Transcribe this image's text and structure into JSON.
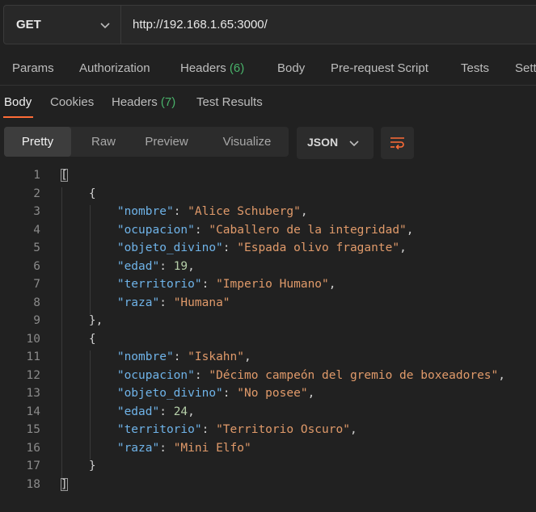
{
  "request": {
    "method": "GET",
    "url": "http://192.168.1.65:3000/"
  },
  "request_tabs": [
    {
      "label": "Params",
      "count": ""
    },
    {
      "label": "Authorization",
      "count": ""
    },
    {
      "label": "Headers",
      "count": "(6)"
    },
    {
      "label": "Body",
      "count": ""
    },
    {
      "label": "Pre-request Script",
      "count": ""
    },
    {
      "label": "Tests",
      "count": ""
    },
    {
      "label": "Sett",
      "count": ""
    }
  ],
  "response_tabs": [
    {
      "label": "Body",
      "count": ""
    },
    {
      "label": "Cookies",
      "count": ""
    },
    {
      "label": "Headers",
      "count": "(7)"
    },
    {
      "label": "Test Results",
      "count": ""
    }
  ],
  "view_modes": [
    "Pretty",
    "Raw",
    "Preview",
    "Visualize"
  ],
  "active_view_mode": "Pretty",
  "format": "JSON",
  "colors": {
    "accent": "#ff6c37",
    "count": "#49b26a",
    "key": "#6fb3e8",
    "string": "#e09a6a",
    "number": "#b5cea8"
  },
  "response_body": [
    {
      "nombre": "Alice Schuberg",
      "ocupacion": "Caballero de la integridad",
      "objeto_divino": "Espada olivo fragante",
      "edad": 19,
      "territorio": "Imperio Humano",
      "raza": "Humana"
    },
    {
      "nombre": "Iskahn",
      "ocupacion": "Décimo campeón del gremio de boxeadores",
      "objeto_divino": "No posee",
      "edad": 24,
      "territorio": "Territorio Oscuro",
      "raza": "Mini Elfo"
    }
  ],
  "code_lines": [
    {
      "n": "1",
      "tokens": [
        {
          "t": "p",
          "v": "["
        }
      ]
    },
    {
      "n": "2",
      "tokens": [
        {
          "t": "p",
          "v": "    {"
        }
      ]
    },
    {
      "n": "3",
      "tokens": [
        {
          "t": "p",
          "v": "        "
        },
        {
          "t": "k",
          "v": "\"nombre\""
        },
        {
          "t": "p",
          "v": ": "
        },
        {
          "t": "s",
          "v": "\"Alice Schuberg\""
        },
        {
          "t": "p",
          "v": ","
        }
      ]
    },
    {
      "n": "4",
      "tokens": [
        {
          "t": "p",
          "v": "        "
        },
        {
          "t": "k",
          "v": "\"ocupacion\""
        },
        {
          "t": "p",
          "v": ": "
        },
        {
          "t": "s",
          "v": "\"Caballero de la integridad\""
        },
        {
          "t": "p",
          "v": ","
        }
      ]
    },
    {
      "n": "5",
      "tokens": [
        {
          "t": "p",
          "v": "        "
        },
        {
          "t": "k",
          "v": "\"objeto_divino\""
        },
        {
          "t": "p",
          "v": ": "
        },
        {
          "t": "s",
          "v": "\"Espada olivo fragante\""
        },
        {
          "t": "p",
          "v": ","
        }
      ]
    },
    {
      "n": "6",
      "tokens": [
        {
          "t": "p",
          "v": "        "
        },
        {
          "t": "k",
          "v": "\"edad\""
        },
        {
          "t": "p",
          "v": ": "
        },
        {
          "t": "n",
          "v": "19"
        },
        {
          "t": "p",
          "v": ","
        }
      ]
    },
    {
      "n": "7",
      "tokens": [
        {
          "t": "p",
          "v": "        "
        },
        {
          "t": "k",
          "v": "\"territorio\""
        },
        {
          "t": "p",
          "v": ": "
        },
        {
          "t": "s",
          "v": "\"Imperio Humano\""
        },
        {
          "t": "p",
          "v": ","
        }
      ]
    },
    {
      "n": "8",
      "tokens": [
        {
          "t": "p",
          "v": "        "
        },
        {
          "t": "k",
          "v": "\"raza\""
        },
        {
          "t": "p",
          "v": ": "
        },
        {
          "t": "s",
          "v": "\"Humana\""
        }
      ]
    },
    {
      "n": "9",
      "tokens": [
        {
          "t": "p",
          "v": "    },"
        }
      ]
    },
    {
      "n": "10",
      "tokens": [
        {
          "t": "p",
          "v": "    {"
        }
      ]
    },
    {
      "n": "11",
      "tokens": [
        {
          "t": "p",
          "v": "        "
        },
        {
          "t": "k",
          "v": "\"nombre\""
        },
        {
          "t": "p",
          "v": ": "
        },
        {
          "t": "s",
          "v": "\"Iskahn\""
        },
        {
          "t": "p",
          "v": ","
        }
      ]
    },
    {
      "n": "12",
      "tokens": [
        {
          "t": "p",
          "v": "        "
        },
        {
          "t": "k",
          "v": "\"ocupacion\""
        },
        {
          "t": "p",
          "v": ": "
        },
        {
          "t": "s",
          "v": "\"Décimo campeón del gremio de boxeadores\""
        },
        {
          "t": "p",
          "v": ","
        }
      ]
    },
    {
      "n": "13",
      "tokens": [
        {
          "t": "p",
          "v": "        "
        },
        {
          "t": "k",
          "v": "\"objeto_divino\""
        },
        {
          "t": "p",
          "v": ": "
        },
        {
          "t": "s",
          "v": "\"No posee\""
        },
        {
          "t": "p",
          "v": ","
        }
      ]
    },
    {
      "n": "14",
      "tokens": [
        {
          "t": "p",
          "v": "        "
        },
        {
          "t": "k",
          "v": "\"edad\""
        },
        {
          "t": "p",
          "v": ": "
        },
        {
          "t": "n",
          "v": "24"
        },
        {
          "t": "p",
          "v": ","
        }
      ]
    },
    {
      "n": "15",
      "tokens": [
        {
          "t": "p",
          "v": "        "
        },
        {
          "t": "k",
          "v": "\"territorio\""
        },
        {
          "t": "p",
          "v": ": "
        },
        {
          "t": "s",
          "v": "\"Territorio Oscuro\""
        },
        {
          "t": "p",
          "v": ","
        }
      ]
    },
    {
      "n": "16",
      "tokens": [
        {
          "t": "p",
          "v": "        "
        },
        {
          "t": "k",
          "v": "\"raza\""
        },
        {
          "t": "p",
          "v": ": "
        },
        {
          "t": "s",
          "v": "\"Mini Elfo\""
        }
      ]
    },
    {
      "n": "17",
      "tokens": [
        {
          "t": "p",
          "v": "    }"
        }
      ]
    },
    {
      "n": "18",
      "tokens": [
        {
          "t": "p",
          "v": "]"
        }
      ]
    }
  ]
}
